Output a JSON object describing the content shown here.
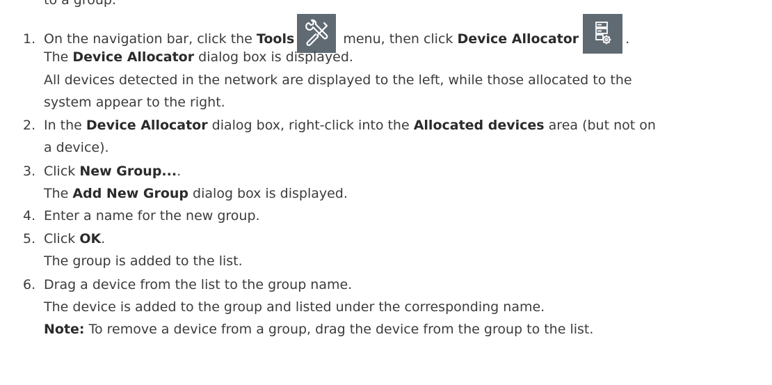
{
  "intro_partial": "to a group.",
  "steps": [
    {
      "num": "1.",
      "l1_a": "On the navigation bar, click the ",
      "l1_b": "Tools",
      "l1_c": " menu, then click ",
      "l1_d": "Device Allocator",
      "l1_e": ".",
      "l2_a": "The ",
      "l2_b": "Device Allocator",
      "l2_c": " dialog box is displayed.",
      "l3": "All devices detected in the network are displayed to the left, while those allocated to the",
      "l4": "system appear to the right."
    },
    {
      "num": "2.",
      "l1_a": "In the ",
      "l1_b": "Device Allocator",
      "l1_c": " dialog box, right-click into the ",
      "l1_d": "Allocated devices",
      "l1_e": " area (but not on",
      "l2": "a device)."
    },
    {
      "num": "3.",
      "l1_a": "Click ",
      "l1_b": "New Group...",
      "l1_c": ".",
      "l2_a": "The ",
      "l2_b": "Add New Group",
      "l2_c": " dialog box is displayed."
    },
    {
      "num": "4.",
      "l1": "Enter a name for the new group."
    },
    {
      "num": "5.",
      "l1_a": "Click ",
      "l1_b": "OK",
      "l1_c": ".",
      "l2": "The group is added to the list."
    },
    {
      "num": "6.",
      "l1": "Drag a device from the list to the group name.",
      "l2": "The device is added to the group and listed under the corresponding name.",
      "l3_a": "Note:",
      "l3_b": " To remove a device from a group, drag the device from the group to the list."
    }
  ],
  "icons": {
    "tools": "tools-icon",
    "device_allocator": "device-allocator-icon",
    "icon_bg": "#5f6a73",
    "icon_fg": "#ffffff"
  }
}
